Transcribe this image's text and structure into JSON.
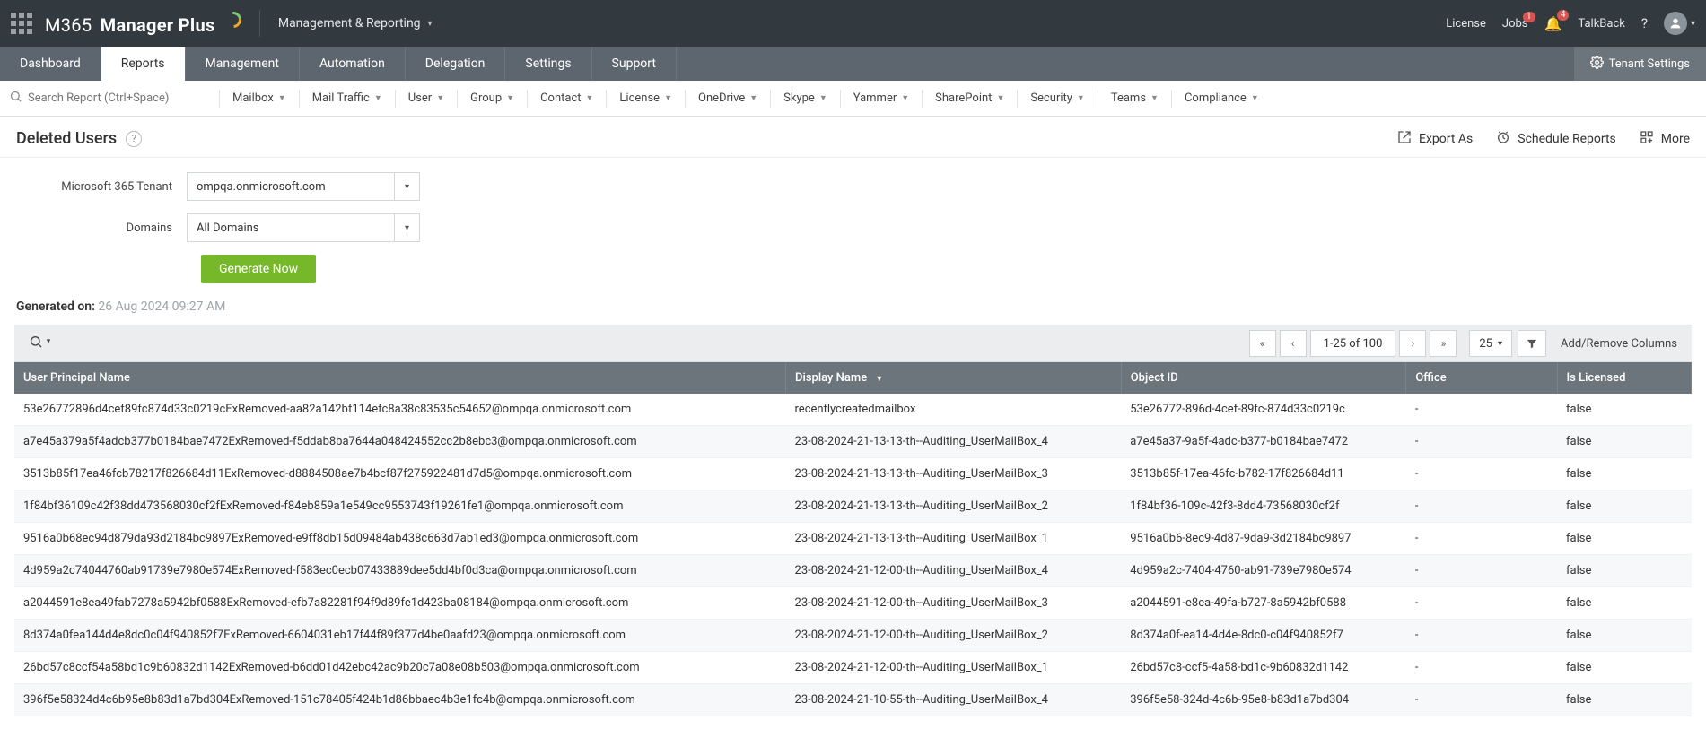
{
  "topbar": {
    "brand_prefix": "M365",
    "brand_suffix": "Manager Plus",
    "breadcrumb": "Management & Reporting",
    "license": "License",
    "jobs": "Jobs",
    "jobs_badge": "1",
    "notif_badge": "4",
    "talkback": "TalkBack"
  },
  "primarynav": {
    "items": [
      "Dashboard",
      "Reports",
      "Management",
      "Automation",
      "Delegation",
      "Settings",
      "Support"
    ],
    "active_index": 1,
    "tenant_settings": "Tenant Settings"
  },
  "secondarynav": {
    "search_placeholder": "Search Report (Ctrl+Space)",
    "items": [
      "Mailbox",
      "Mail Traffic",
      "User",
      "Group",
      "Contact",
      "License",
      "OneDrive",
      "Skype",
      "Yammer",
      "SharePoint",
      "Security",
      "Teams",
      "Compliance"
    ]
  },
  "page": {
    "title": "Deleted Users",
    "export_as": "Export As",
    "schedule": "Schedule Reports",
    "more": "More"
  },
  "filters": {
    "tenant_label": "Microsoft 365 Tenant",
    "tenant_value": "ompqa.onmicrosoft.com",
    "domains_label": "Domains",
    "domains_value": "All Domains",
    "generate": "Generate Now"
  },
  "meta": {
    "generated_on_label": "Generated on:",
    "generated_on_value": "26 Aug 2024 09:27 AM"
  },
  "toolbar": {
    "range_text": "1-25 of 100",
    "per_page": "25",
    "add_cols": "Add/Remove Columns"
  },
  "table": {
    "headers": {
      "upn": "User Principal Name",
      "display": "Display Name",
      "obj": "Object ID",
      "office": "Office",
      "licensed": "Is Licensed"
    },
    "rows": [
      {
        "upn": "53e26772896d4cef89fc874d33c0219cExRemoved-aa82a142bf114efc8a38c83535c54652@ompqa.onmicrosoft.com",
        "display": "recentlycreatedmailbox",
        "obj": "53e26772-896d-4cef-89fc-874d33c0219c",
        "office": "-",
        "licensed": "false"
      },
      {
        "upn": "a7e45a379a5f4adcb377b0184bae7472ExRemoved-f5ddab8ba7644a048424552cc2b8ebc3@ompqa.onmicrosoft.com",
        "display": "23-08-2024-21-13-13-th--Auditing_UserMailBox_4",
        "obj": "a7e45a37-9a5f-4adc-b377-b0184bae7472",
        "office": "-",
        "licensed": "false"
      },
      {
        "upn": "3513b85f17ea46fcb78217f826684d11ExRemoved-d8884508ae7b4bcf87f275922481d7d5@ompqa.onmicrosoft.com",
        "display": "23-08-2024-21-13-13-th--Auditing_UserMailBox_3",
        "obj": "3513b85f-17ea-46fc-b782-17f826684d11",
        "office": "-",
        "licensed": "false"
      },
      {
        "upn": "1f84bf36109c42f38dd473568030cf2fExRemoved-f84eb859a1e549cc9553743f19261fe1@ompqa.onmicrosoft.com",
        "display": "23-08-2024-21-13-13-th--Auditing_UserMailBox_2",
        "obj": "1f84bf36-109c-42f3-8dd4-73568030cf2f",
        "office": "-",
        "licensed": "false"
      },
      {
        "upn": "9516a0b68ec94d879da93d2184bc9897ExRemoved-e9ff8db15d09484ab438c663d7ab1ed3@ompqa.onmicrosoft.com",
        "display": "23-08-2024-21-13-13-th--Auditing_UserMailBox_1",
        "obj": "9516a0b6-8ec9-4d87-9da9-3d2184bc9897",
        "office": "-",
        "licensed": "false"
      },
      {
        "upn": "4d959a2c74044760ab91739e7980e574ExRemoved-f583ec0ecb07433889dee5dd4bf0d3ca@ompqa.onmicrosoft.com",
        "display": "23-08-2024-21-12-00-th--Auditing_UserMailBox_4",
        "obj": "4d959a2c-7404-4760-ab91-739e7980e574",
        "office": "-",
        "licensed": "false"
      },
      {
        "upn": "a2044591e8ea49fab7278a5942bf0588ExRemoved-efb7a82281f94f9d89fe1d423ba08184@ompqa.onmicrosoft.com",
        "display": "23-08-2024-21-12-00-th--Auditing_UserMailBox_3",
        "obj": "a2044591-e8ea-49fa-b727-8a5942bf0588",
        "office": "-",
        "licensed": "false"
      },
      {
        "upn": "8d374a0fea144d4e8dc0c04f940852f7ExRemoved-6604031eb17f44f89f377d4be0aafd23@ompqa.onmicrosoft.com",
        "display": "23-08-2024-21-12-00-th--Auditing_UserMailBox_2",
        "obj": "8d374a0f-ea14-4d4e-8dc0-c04f940852f7",
        "office": "-",
        "licensed": "false"
      },
      {
        "upn": "26bd57c8ccf54a58bd1c9b60832d1142ExRemoved-b6dd01d42ebc42ac9b20c7a08e08b503@ompqa.onmicrosoft.com",
        "display": "23-08-2024-21-12-00-th--Auditing_UserMailBox_1",
        "obj": "26bd57c8-ccf5-4a58-bd1c-9b60832d1142",
        "office": "-",
        "licensed": "false"
      },
      {
        "upn": "396f5e58324d4c6b95e8b83d1a7bd304ExRemoved-151c78405f424b1d86bbaec4b3e1fc4b@ompqa.onmicrosoft.com",
        "display": "23-08-2024-21-10-55-th--Auditing_UserMailBox_4",
        "obj": "396f5e58-324d-4c6b-95e8-b83d1a7bd304",
        "office": "-",
        "licensed": "false"
      }
    ]
  }
}
